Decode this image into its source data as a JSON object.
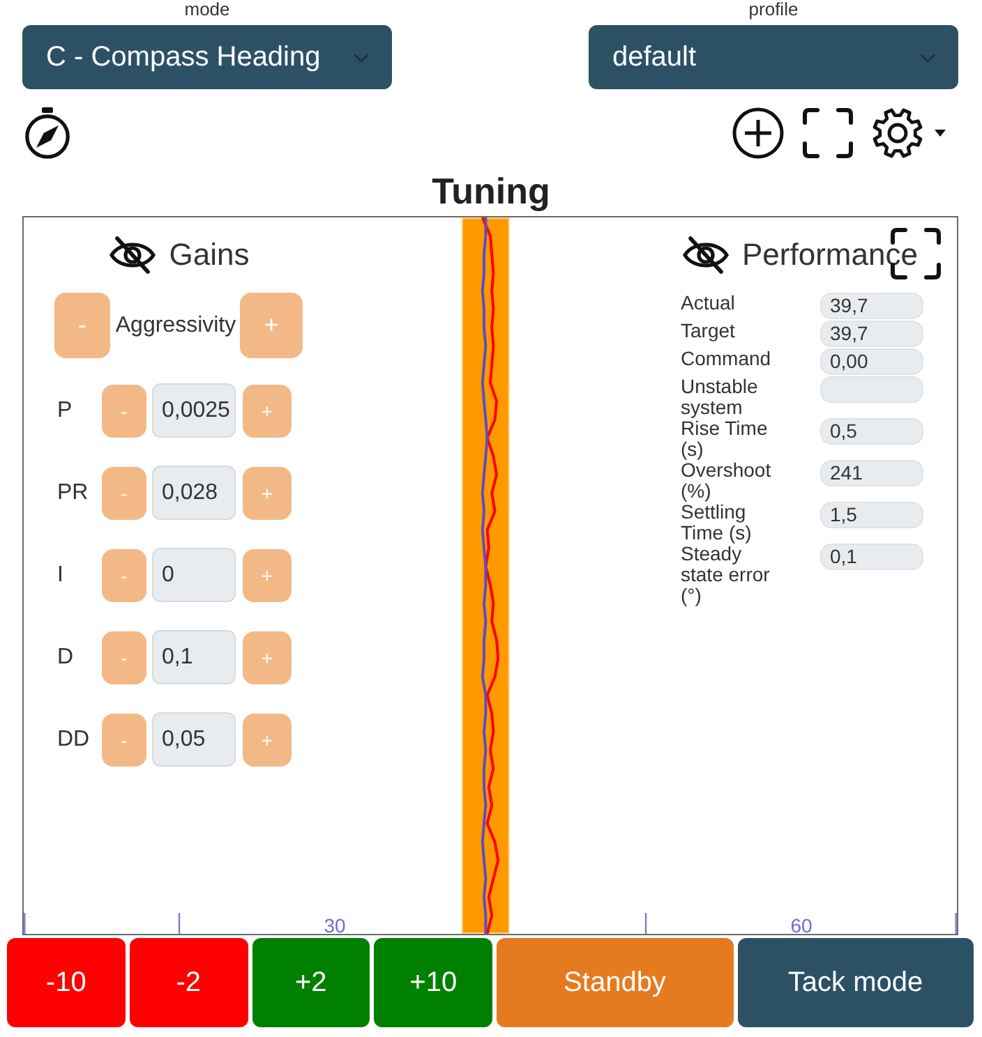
{
  "mode": {
    "label": "mode",
    "value": "C - Compass Heading"
  },
  "profile": {
    "label": "profile",
    "value": "default"
  },
  "tuning": {
    "title": "Tuning",
    "gains": {
      "title": "Gains",
      "aggressivity": {
        "label": "Aggressivity",
        "minus": "-",
        "plus": "+"
      },
      "rows": [
        {
          "label": "P",
          "value": "0,0025",
          "minus": "-",
          "plus": "+"
        },
        {
          "label": "PR",
          "value": "0,028",
          "minus": "-",
          "plus": "+"
        },
        {
          "label": "I",
          "value": "0",
          "minus": "-",
          "plus": "+"
        },
        {
          "label": "D",
          "value": "0,1",
          "minus": "-",
          "plus": "+"
        },
        {
          "label": "DD",
          "value": "0,05",
          "minus": "-",
          "plus": "+"
        }
      ]
    },
    "performance": {
      "title": "Performance",
      "rows": [
        {
          "label": "Actual",
          "value": "39,7"
        },
        {
          "label": "Target",
          "value": "39,7"
        },
        {
          "label": "Command",
          "value": "0,00"
        },
        {
          "label": "Unstable system"
        },
        {
          "label": "Rise Time (s)",
          "value": "0,5"
        },
        {
          "label": "Overshoot (%)",
          "value": "241"
        },
        {
          "label": "Settling Time (s)",
          "value": "1,5"
        },
        {
          "label": "Steady state error (°)",
          "value": "0,1"
        }
      ]
    },
    "axis_labels": [
      "30",
      "60"
    ]
  },
  "buttons": [
    {
      "label": "-10",
      "color": "#ff0000"
    },
    {
      "label": "-2",
      "color": "#ff0000"
    },
    {
      "label": "+2",
      "color": "#008000"
    },
    {
      "label": "+10",
      "color": "#008000"
    },
    {
      "label": "Standby",
      "color": "#e67a1e"
    },
    {
      "label": "Tack mode",
      "color": "#2c5064"
    }
  ]
}
